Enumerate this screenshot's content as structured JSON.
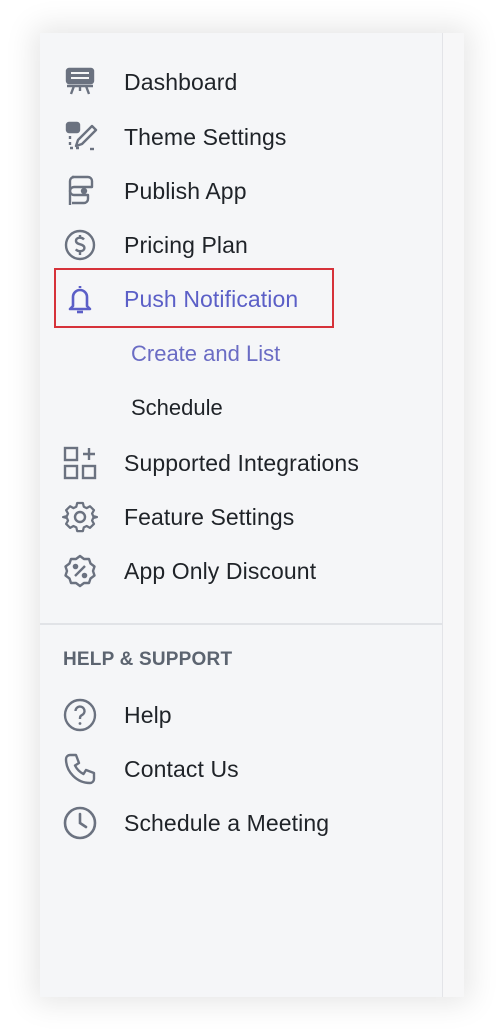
{
  "nav": {
    "items": [
      {
        "label": "Dashboard",
        "icon": "dashboard-icon"
      },
      {
        "label": "Theme Settings",
        "icon": "theme-edit-icon"
      },
      {
        "label": "Publish App",
        "icon": "publish-app-icon"
      },
      {
        "label": "Pricing Plan",
        "icon": "dollar-icon"
      },
      {
        "label": "Push Notification",
        "icon": "bell-icon",
        "active": true
      },
      {
        "label": "Supported Integrations",
        "icon": "integrations-icon"
      },
      {
        "label": "Feature Settings",
        "icon": "gear-icon"
      },
      {
        "label": "App Only Discount",
        "icon": "discount-icon"
      }
    ],
    "sub_items": [
      {
        "label": "Create and List",
        "active": true
      },
      {
        "label": "Schedule"
      }
    ]
  },
  "support": {
    "title": "HELP & SUPPORT",
    "items": [
      {
        "label": "Help",
        "icon": "help-icon"
      },
      {
        "label": "Contact Us",
        "icon": "phone-icon"
      },
      {
        "label": "Schedule a Meeting",
        "icon": "clock-icon"
      }
    ]
  },
  "colors": {
    "active": "#5b5fc7",
    "highlight_border": "#d6323a",
    "icon_gray": "#6b7280",
    "text": "#1f2328"
  }
}
